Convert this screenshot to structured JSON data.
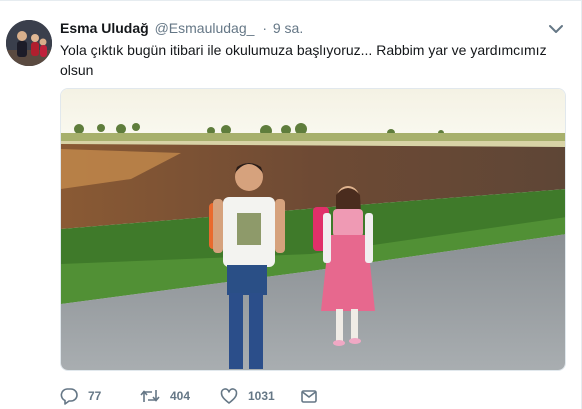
{
  "tweet": {
    "author_name": "Esma Uludağ",
    "author_handle": "@Esmauludag_",
    "separator": "·",
    "time": "9 sa.",
    "text": "Yola çıktık bugün itibari ile okulumuza başlıyoruz... Rabbim yar ve yardımcımız olsun",
    "media_icon": "photo-of-two-children-with-backpacks"
  },
  "actions": {
    "reply": {
      "icon": "reply-icon",
      "count": "77"
    },
    "retweet": {
      "icon": "retweet-icon",
      "count": "404"
    },
    "like": {
      "icon": "heart-icon",
      "count": "1031"
    },
    "direct_message": {
      "icon": "envelope-icon"
    }
  },
  "colors": {
    "text_primary": "#14171a",
    "text_secondary": "#657786",
    "border": "#e1e8ed"
  }
}
